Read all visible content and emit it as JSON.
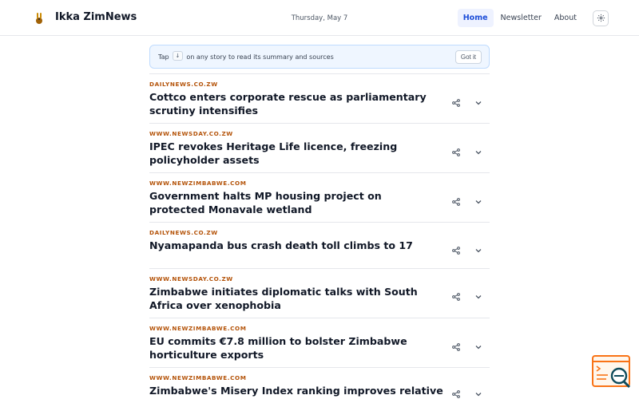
{
  "header": {
    "brand": "Ikka ZimNews",
    "date": "Thursday, May 7",
    "nav": [
      {
        "label": "Home",
        "active": true
      },
      {
        "label": "Newsletter",
        "active": false
      },
      {
        "label": "About",
        "active": false
      }
    ],
    "settings_icon": "gear-icon",
    "logo_icon": "rabbit-icon"
  },
  "tip": {
    "prefix": "Tap",
    "key": "↓",
    "suffix": "on any story to read its summary and sources",
    "dismiss_label": "Got it"
  },
  "articles": [
    {
      "source": "DAILYNEWS.CO.ZW",
      "title": "Cottco enters corporate rescue as parliamentary scrutiny intensifies"
    },
    {
      "source": "WWW.NEWSDAY.CO.ZW",
      "title": "IPEC revokes Heritage Life licence, freezing policyholder assets"
    },
    {
      "source": "WWW.NEWZIMBABWE.COM",
      "title": "Government halts MP housing project on protected Monavale wetland"
    },
    {
      "source": "DAILYNEWS.CO.ZW",
      "title": "Nyamapanda bus crash death toll climbs to 17"
    },
    {
      "source": "WWW.NEWSDAY.CO.ZW",
      "title": "Zimbabwe initiates diplomatic talks with South Africa over xenophobia"
    },
    {
      "source": "WWW.NEWZIMBABWE.COM",
      "title": "EU commits €7.8 million to bolster Zimbabwe horticulture exports"
    },
    {
      "source": "WWW.NEWZIMBABWE.COM",
      "title": "Zimbabwe's Misery Index ranking improves relative to"
    }
  ],
  "colors": {
    "accent": "#1d4ed8",
    "source": "#b45309",
    "tip_bg": "#eff6ff",
    "widget": "#f97316"
  },
  "widget": {
    "icon": "terminal-search-icon"
  }
}
